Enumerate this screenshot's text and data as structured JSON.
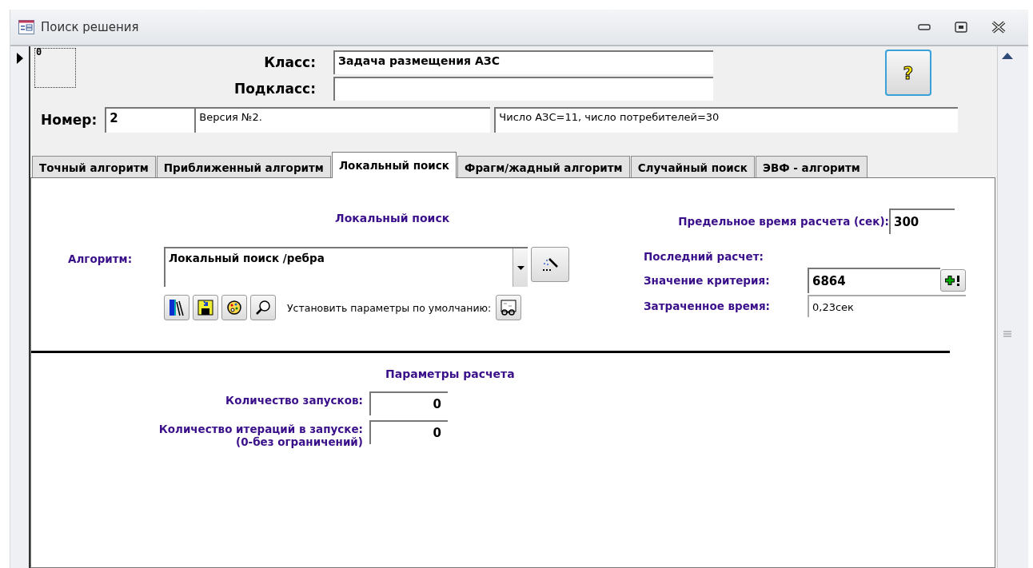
{
  "window": {
    "title": "Поиск решения"
  },
  "record": {
    "marker": "0"
  },
  "header": {
    "class_label": "Класс:",
    "class_value": "Задача размещения АЗС",
    "subclass_label": "Подкласс:",
    "number_label": "Номер:",
    "number_value": "2",
    "version": "Версия №2.",
    "description": "Число АЗС=11, число потребителей=30",
    "help_button": "?"
  },
  "tabs": [
    {
      "label": "Точный алгоритм",
      "selected": false
    },
    {
      "label": "Приближенный алгоритм",
      "selected": false
    },
    {
      "label": "Локальный поиск",
      "selected": true
    },
    {
      "label": "Фрагм/жадный алгоритм",
      "selected": false
    },
    {
      "label": "Случайный поиск",
      "selected": false
    },
    {
      "label": "ЭВФ - алгоритм",
      "selected": false
    }
  ],
  "local_search": {
    "title": "Локальный поиск",
    "time_limit_label": "Предельное время расчета (сек):",
    "time_limit_value": "300",
    "algorithm_label": "Алгоритм:",
    "algorithm_value": "Локальный поиск /ребра",
    "defaults_label": "Установить параметры по умолчанию:",
    "last_run_label": "Последний расчет:",
    "criterion_label": "Значение критерия:",
    "criterion_value": "6864",
    "elapsed_label": "Затраченное время:",
    "elapsed_value": "0,23сек"
  },
  "parameters": {
    "title": "Параметры расчета",
    "fields": [
      {
        "label": "Количество запусков:",
        "value": "0"
      },
      {
        "label": "Количество итераций в запуске:",
        "note": "(0-без ограничений)",
        "value": "0"
      }
    ]
  }
}
